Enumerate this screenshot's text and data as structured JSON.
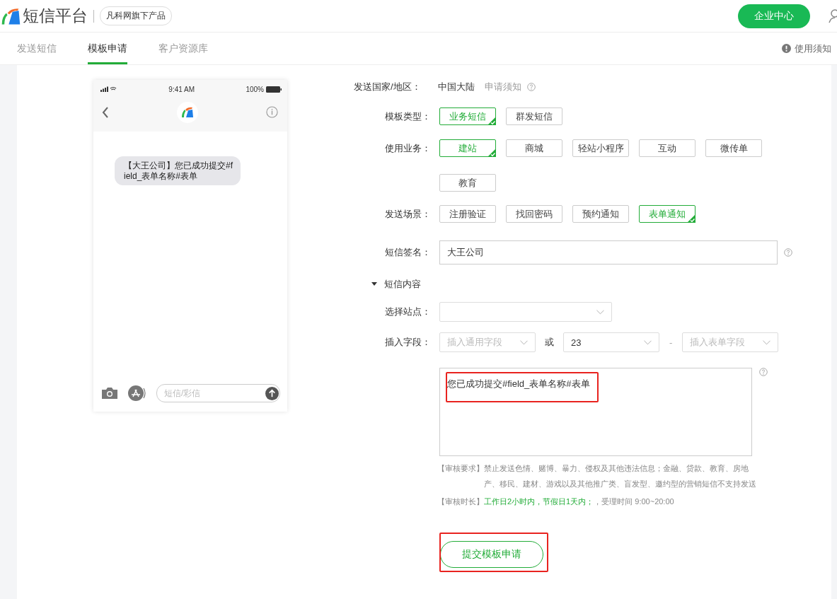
{
  "header": {
    "brand": "短信平台",
    "tagline": "凡科网旗下产品",
    "enterprise_button": "企业中心"
  },
  "tabs": [
    {
      "label": "发送短信",
      "selected": false
    },
    {
      "label": "模板申请",
      "selected": true
    },
    {
      "label": "客户资源库",
      "selected": false
    }
  ],
  "help_link": "使用须知",
  "phone": {
    "signal_time": "9:41 AM",
    "battery": "100%",
    "message": "【大王公司】您已成功提交#field_表单名称#表单",
    "input_placeholder": "短信/彩信"
  },
  "form": {
    "country": {
      "label": "发送国家/地区：",
      "value": "中国大陆",
      "link": "申请须知"
    },
    "option_groups": [
      {
        "label": "模板类型：",
        "options": [
          {
            "label": "业务短信",
            "selected": true
          },
          {
            "label": "群发短信",
            "selected": false
          }
        ]
      },
      {
        "label": "使用业务：",
        "options": [
          {
            "label": "建站",
            "selected": true
          },
          {
            "label": "商城",
            "selected": false
          },
          {
            "label": "轻站小程序",
            "selected": false
          },
          {
            "label": "互动",
            "selected": false
          },
          {
            "label": "微传单",
            "selected": false
          },
          {
            "label": "教育",
            "selected": false
          }
        ]
      },
      {
        "label": "发送场景：",
        "options": [
          {
            "label": "注册验证",
            "selected": false
          },
          {
            "label": "找回密码",
            "selected": false
          },
          {
            "label": "预约通知",
            "selected": false
          },
          {
            "label": "表单通知",
            "selected": true
          }
        ]
      }
    ],
    "signature": {
      "label": "短信签名：",
      "value": "大王公司"
    },
    "section": {
      "title": "短信内容",
      "expanded": true
    },
    "site": {
      "label": "选择站点："
    },
    "insert": {
      "label": "插入字段：",
      "general_placeholder": "插入通用字段",
      "or": "或",
      "form_value": "23",
      "dash": "-",
      "field_placeholder": "插入表单字段"
    },
    "content": "您已成功提交#field_表单名称#表单",
    "review_requirement": {
      "label": "【审核要求】",
      "text": "禁止发送色情、赌博、暴力、侵权及其他违法信息；金融、贷款、教育、房地产、移民、建材、游戏以及其他推广类、盲发型、邀约型的营销短信不支持发送"
    },
    "review_duration": {
      "label": "【审核时长】",
      "highlight": "工作日2小时内，节假日1天内；",
      "text": "，受理时间 9:00~20:00"
    },
    "submit": "提交模板申请"
  }
}
